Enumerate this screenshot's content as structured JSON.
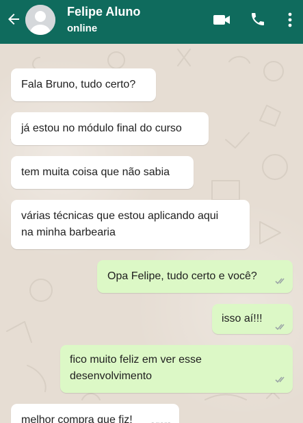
{
  "header": {
    "contact_name": "Felipe Aluno",
    "status": "online",
    "icons": [
      "back-arrow-icon",
      "avatar-placeholder-icon",
      "video-call-icon",
      "phone-icon",
      "more-options-icon"
    ],
    "colors": {
      "bar": "#0f6b5d",
      "text": "#ffffff"
    }
  },
  "chat": {
    "colors": {
      "background": "#e6ddd3",
      "incoming_bubble": "#ffffff",
      "outgoing_bubble": "#dcf8c6",
      "ticks": "#9aa3a6"
    },
    "messages": [
      {
        "direction": "in",
        "lines": [
          "Fala Bruno, tudo certo?"
        ]
      },
      {
        "direction": "in",
        "lines": [
          "já estou no módulo final do curso"
        ]
      },
      {
        "direction": "in",
        "lines": [
          "tem muita coisa que não sabia"
        ]
      },
      {
        "direction": "in",
        "lines": [
          "várias técnicas que estou aplicando aqui",
          "na minha barbearia"
        ]
      },
      {
        "direction": "out",
        "lines": [
          "Opa Felipe, tudo certo e você?"
        ],
        "status": "read"
      },
      {
        "direction": "out",
        "lines": [
          "isso aí!!!"
        ],
        "status": "read"
      },
      {
        "direction": "out",
        "lines": [
          "fico muito feliz em ver esse",
          "desenvolvimento"
        ],
        "status": "read"
      },
      {
        "direction": "in",
        "lines": [
          "melhor compra que fiz!"
        ],
        "time": "agora"
      }
    ]
  }
}
